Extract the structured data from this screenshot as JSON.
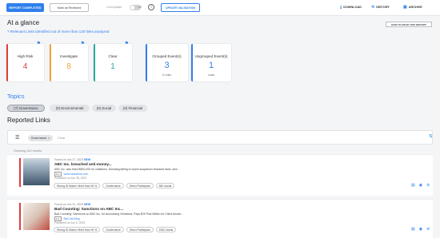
{
  "toolbar": {
    "report_completed": "REPORT COMPLETED",
    "mark_reviewed": "Mark as Reviewed",
    "live_update": "LiveUpdate",
    "toggle_state": "Off",
    "update_validation": "UPDATE VALIDATION",
    "download": "DOWNLOAD",
    "history": "HISTORY",
    "archive": "ARCHIVE"
  },
  "glance": {
    "title": "At a glance",
    "subtitle": "Relevant Links identified out of more than 120 links analyzed",
    "read_report": "HOW TO READ THIS REPORT",
    "cards": [
      {
        "label": "High Risk",
        "value": "4",
        "color": "#e03b3b"
      },
      {
        "label": "Investigate",
        "value": "8",
        "color": "#f2a43a"
      },
      {
        "label": "Clear",
        "value": "1",
        "color": "#2aa6a0"
      }
    ],
    "events": [
      {
        "label": "Grouped Event(s)",
        "value": "3",
        "unit": "5 Links"
      },
      {
        "label": "Ungrouped Event(s)",
        "value": "1",
        "unit": "Links"
      }
    ]
  },
  "topics": {
    "title": "Topics",
    "chips": [
      {
        "label": "(7) Governance",
        "selected": true
      },
      {
        "label": "(0) Environmental",
        "selected": false
      },
      {
        "label": "(0) Social",
        "selected": false
      },
      {
        "label": "(0) Financial",
        "selected": false
      }
    ]
  },
  "links": {
    "title": "Reported Links",
    "filter_chip": "Governance",
    "clear": "Clear",
    "results": "Showing 144 results",
    "items": [
      {
        "found": "Found on Jun 27, 2023",
        "new_label": "NEW",
        "title": "ABC Inc. breached anti-money...",
        "snippet": "ABC Inc. was fined $500,000 for violations, including failing to report suspicious financial trans, and...",
        "source_tag": "link",
        "source": "www.newstime.com",
        "published": "Published on Jun 28, 2023",
        "tags": [
          "Strong ID Match: More than 90 %",
          "Governance",
          "Direct Participant",
          "562 words"
        ]
      },
      {
        "found": "Found on Jun 21, 2023",
        "new_label": "NEW",
        "title": "Bad Counting: Sanctions on ABC Inc...",
        "snippet": "Bad Counting: Sanctions on ABC Inc. for Accounting Violations, Pays $29 Plus Million for Client Abuse...",
        "source_tag": "link",
        "source": "BizCuts Blog",
        "published": "Published on Jun 6, 2023",
        "tags": [
          "Strong ID Match: More than 90 %",
          "Governance",
          "Direct Participant",
          "1532 words"
        ]
      }
    ]
  }
}
